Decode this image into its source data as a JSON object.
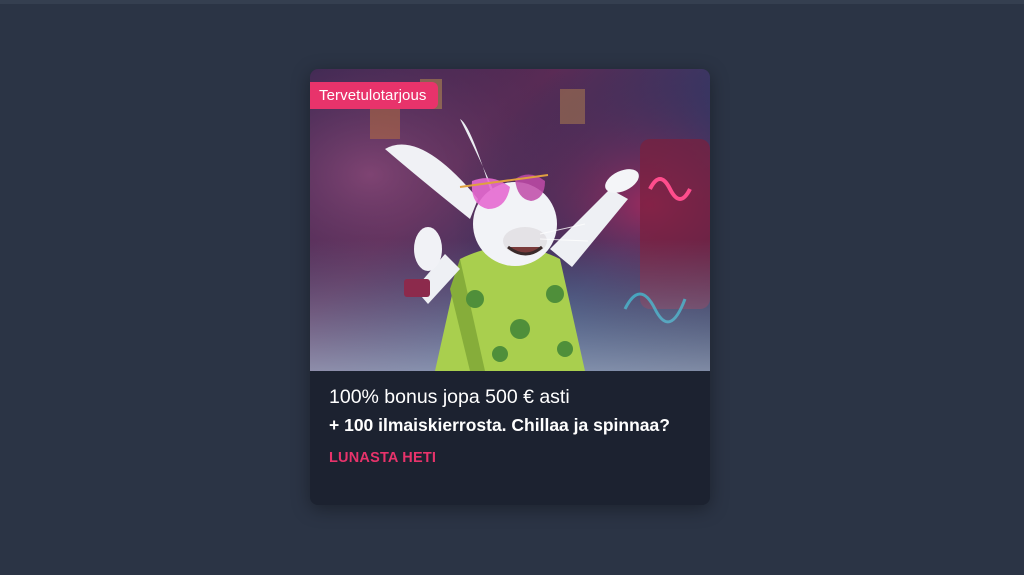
{
  "page": {
    "background": "#2b3445"
  },
  "promo_card": {
    "badge": "Tervetulotarjous",
    "title": "100% bonus jopa 500 € asti",
    "subtitle": "+ 100 ilmaiskierrosta. Chillaa ja spinnaa?",
    "cta": "LUNASTA HETI",
    "image": "white-rabbit-mascot-illustration",
    "accent_color": "#e8336b",
    "card_color": "#1c2230"
  }
}
